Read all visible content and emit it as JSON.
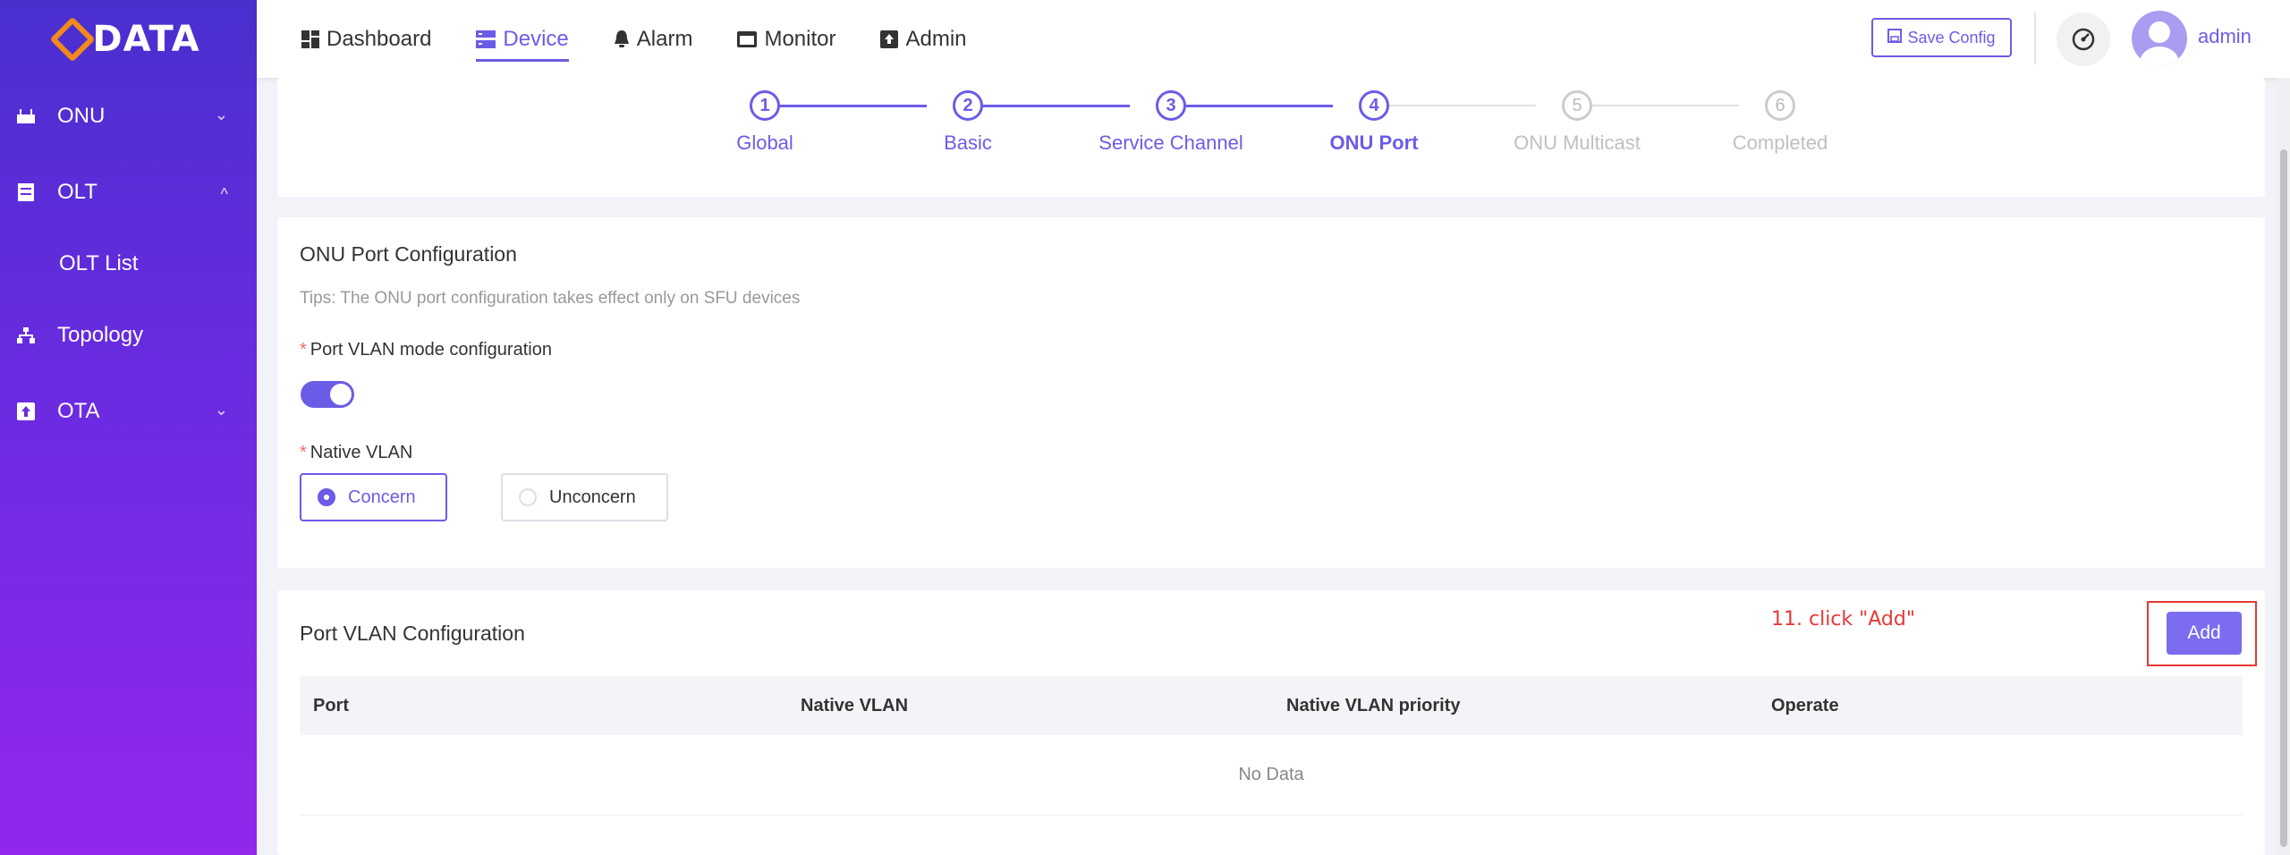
{
  "sidebar": {
    "logo": "DATA",
    "items": [
      {
        "label": "ONU",
        "icon": "onu-icon",
        "chevron": "chevron-down"
      },
      {
        "label": "OLT",
        "icon": "server-icon",
        "chevron": "chevron-up"
      },
      {
        "label": "OLT List"
      },
      {
        "label": "Topology",
        "icon": "topology-icon"
      },
      {
        "label": "OTA",
        "icon": "upload-icon",
        "chevron": "chevron-down"
      }
    ]
  },
  "topnav": {
    "tabs": [
      {
        "label": "Dashboard",
        "icon": "dashboard-icon"
      },
      {
        "label": "Device",
        "icon": "device-icon",
        "active": true
      },
      {
        "label": "Alarm",
        "icon": "bell-icon"
      },
      {
        "label": "Monitor",
        "icon": "monitor-icon"
      },
      {
        "label": "Admin",
        "icon": "admin-icon"
      }
    ],
    "save_config": "Save Config",
    "user": "admin"
  },
  "steps": [
    {
      "num": "1",
      "label": "Global",
      "state": "done"
    },
    {
      "num": "2",
      "label": "Basic",
      "state": "done"
    },
    {
      "num": "3",
      "label": "Service Channel",
      "state": "done"
    },
    {
      "num": "4",
      "label": "ONU Port",
      "state": "current"
    },
    {
      "num": "5",
      "label": "ONU Multicast",
      "state": "pending"
    },
    {
      "num": "6",
      "label": "Completed",
      "state": "pending"
    }
  ],
  "onu_port": {
    "title": "ONU Port Configuration",
    "tips": "Tips: The ONU port configuration takes effect only on SFU devices",
    "vlan_mode_label": "Port VLAN mode configuration",
    "vlan_mode_enabled": true,
    "native_vlan_label": "Native VLAN",
    "options": [
      {
        "label": "Concern",
        "checked": true
      },
      {
        "label": "Unconcern",
        "checked": false
      }
    ]
  },
  "port_vlan": {
    "title": "Port VLAN Configuration",
    "annotation": "11. click \"Add\"",
    "add_label": "Add",
    "columns": [
      "Port",
      "Native VLAN",
      "Native VLAN priority",
      "Operate"
    ],
    "empty_text": "No Data"
  },
  "colors": {
    "accent": "#6b5ce7",
    "sidebar_top": "#4a2fcf",
    "sidebar_bottom": "#9327ec",
    "annotation": "#e53935"
  }
}
